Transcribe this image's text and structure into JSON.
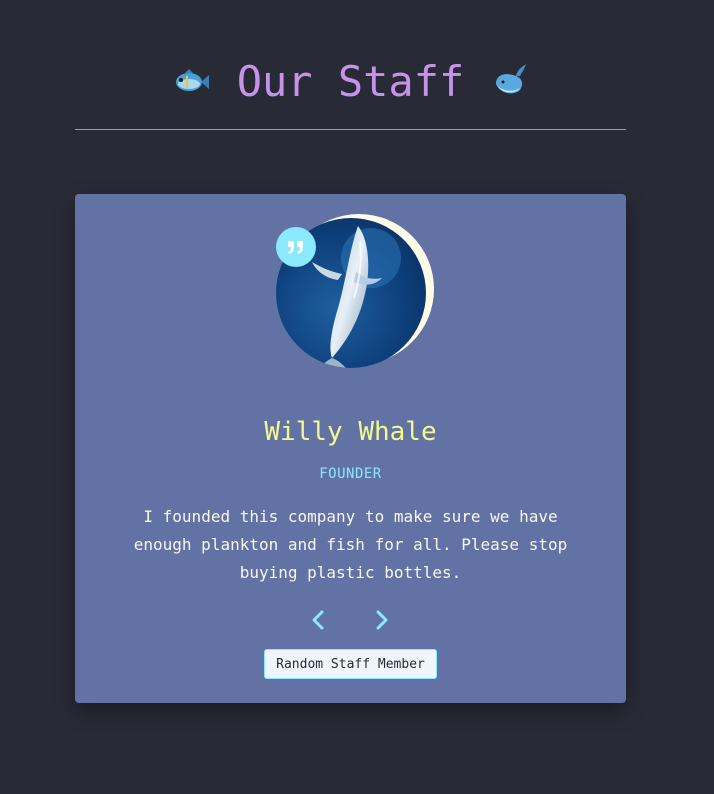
{
  "header": {
    "title": "Our Staff",
    "left_icon": "fish-icon",
    "right_icon": "whale-icon"
  },
  "staff_card": {
    "name": "Willy Whale",
    "role": "FOUNDER",
    "bio": "I founded this company to make sure we have enough plankton and fish for all. Please stop buying plastic bottles.",
    "avatar_icon": "whale-photo",
    "quote_icon": "quote-icon",
    "prev_icon": "chevron-left-icon",
    "next_icon": "chevron-right-icon",
    "random_button_label": "Random Staff Member"
  },
  "colors": {
    "background": "#282a36",
    "title": "#c792ea",
    "card": "#6272a4",
    "name": "#f1fa8c",
    "accent": "#8be9fd",
    "text": "#f8f8f2"
  }
}
